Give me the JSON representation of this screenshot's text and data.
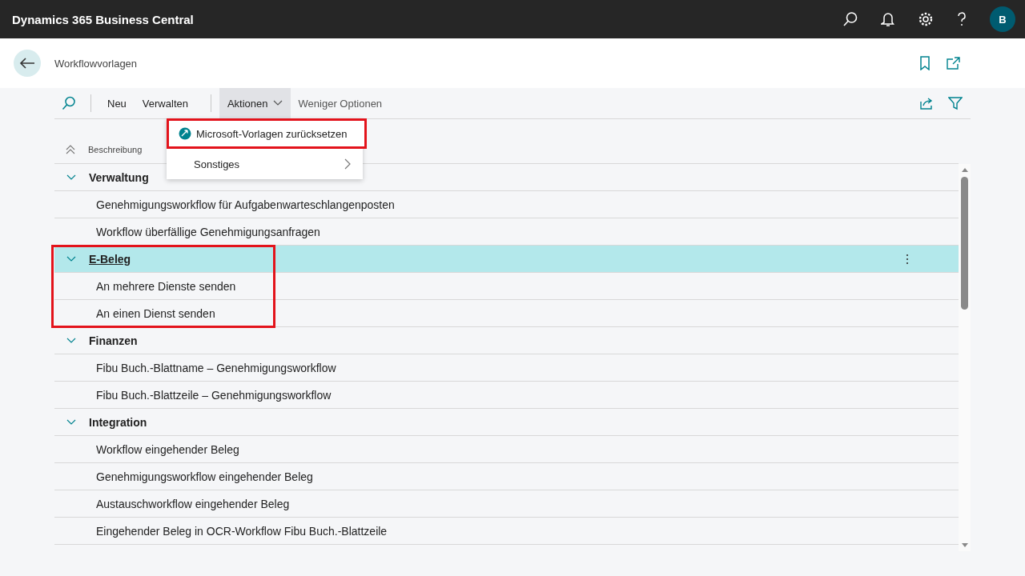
{
  "app_bar": {
    "title": "Dynamics 365 Business Central",
    "avatar": "B"
  },
  "page": {
    "title": "Workflowvorlagen"
  },
  "toolbar": {
    "actions": [
      {
        "label": "Neu",
        "kind": "plain"
      },
      {
        "label": "Verwalten",
        "kind": "plain"
      },
      {
        "label": "Aktionen",
        "kind": "menu",
        "expanded": true
      },
      {
        "label": "Weniger Optionen",
        "kind": "muted"
      }
    ]
  },
  "menu": {
    "items": [
      {
        "label": "Microsoft-Vorlagen zurücksetzen",
        "kind": "action",
        "highlighted": true
      },
      {
        "label": "Sonstiges",
        "kind": "submenu",
        "highlighted": false
      }
    ]
  },
  "table": {
    "column": "Beschreibung",
    "groups": [
      {
        "title": "Verwaltung",
        "expanded": true,
        "selected": false,
        "highlighted": false,
        "rows": [
          "Genehmigungsworkflow für Aufgabenwarteschlangenposten",
          "Workflow überfällige Genehmigungsanfragen"
        ]
      },
      {
        "title": "E-Beleg",
        "expanded": true,
        "selected": true,
        "highlighted": true,
        "rows": [
          "An mehrere Dienste senden",
          "An einen Dienst senden"
        ]
      },
      {
        "title": "Finanzen",
        "expanded": true,
        "selected": false,
        "highlighted": false,
        "rows": [
          "Fibu Buch.-Blattname – Genehmigungsworkflow",
          "Fibu Buch.-Blattzeile – Genehmigungsworkflow"
        ]
      },
      {
        "title": "Integration",
        "expanded": true,
        "selected": false,
        "highlighted": false,
        "rows": [
          "Workflow eingehender Beleg",
          "Genehmigungsworkflow eingehender Beleg",
          "Austauschworkflow eingehender Beleg",
          "Eingehender Beleg in OCR-Workflow Fibu Buch.-Blattzeile"
        ]
      }
    ]
  }
}
